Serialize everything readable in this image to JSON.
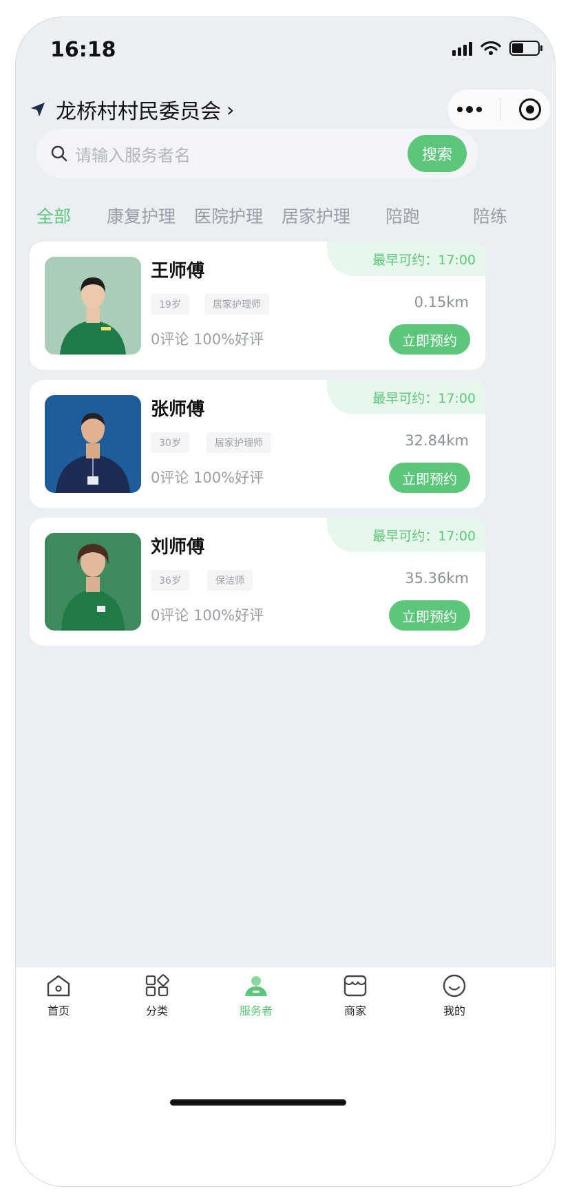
{
  "status_bar": {
    "time": "16:18"
  },
  "header": {
    "location": "龙桥村村民委员会",
    "chevron": "›"
  },
  "search": {
    "placeholder": "请输入服务者名",
    "button": "搜索"
  },
  "tabs": [
    {
      "label": "全部",
      "active": true
    },
    {
      "label": "康复护理",
      "active": false
    },
    {
      "label": "医院护理",
      "active": false
    },
    {
      "label": "居家护理",
      "active": false
    },
    {
      "label": "陪跑",
      "active": false
    },
    {
      "label": "陪练",
      "active": false
    }
  ],
  "workers": [
    {
      "name": "王师傅",
      "age": "19岁",
      "role": "居家护理师",
      "distance": "0.15km",
      "reviews": "0评论 100%好评",
      "availability": "最早可约：17:00",
      "book": "立即预约",
      "shirt_color": "#1e7a48",
      "bg_color": "#a9cdb7"
    },
    {
      "name": "张师傅",
      "age": "30岁",
      "role": "居家护理师",
      "distance": "32.84km",
      "reviews": "0评论 100%好评",
      "availability": "最早可约：17:00",
      "book": "立即预约",
      "shirt_color": "#1c2c55",
      "bg_color": "#1f5c9a"
    },
    {
      "name": "刘师傅",
      "age": "36岁",
      "role": "保洁师",
      "distance": "35.36km",
      "reviews": "0评论 100%好评",
      "availability": "最早可约：17:00",
      "book": "立即预约",
      "shirt_color": "#1f7a45",
      "bg_color": "#3e8a5c"
    }
  ],
  "bottom_nav": [
    {
      "label": "首页",
      "icon": "home-icon",
      "active": false
    },
    {
      "label": "分类",
      "icon": "category-icon",
      "active": false
    },
    {
      "label": "服务者",
      "icon": "worker-icon",
      "active": true
    },
    {
      "label": "商家",
      "icon": "store-icon",
      "active": false
    },
    {
      "label": "我的",
      "icon": "profile-icon",
      "active": false
    }
  ],
  "colors": {
    "accent": "#5cc67a",
    "background": "#ebeff3",
    "avail_bg": "#e8f7ec"
  }
}
